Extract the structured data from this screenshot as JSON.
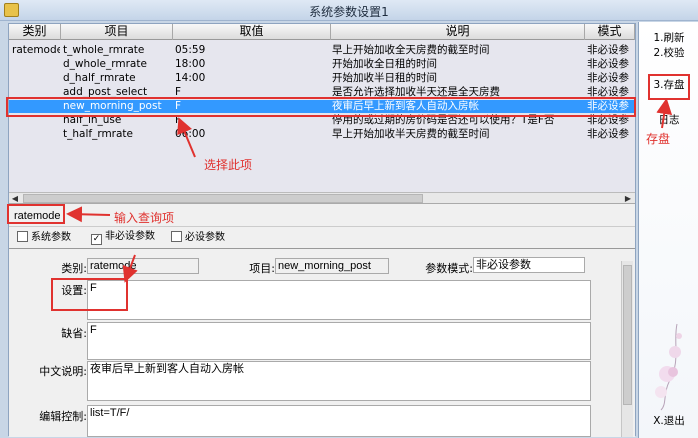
{
  "window": {
    "title": "系统参数设置1"
  },
  "grid": {
    "columns": [
      "类别",
      "项目",
      "取值",
      "说明",
      "模式"
    ],
    "rows": [
      {
        "category": "ratemode",
        "item": "t_whole_rmrate",
        "value": "05:59",
        "desc": "早上开始加收全天房费的截至时间",
        "mode": "非必设参"
      },
      {
        "category": "",
        "item": "d_whole_rmrate",
        "value": "18:00",
        "desc": "开始加收全日租的时间",
        "mode": "非必设参"
      },
      {
        "category": "",
        "item": "d_half_rmrate",
        "value": "14:00",
        "desc": "开始加收半日租的时间",
        "mode": "非必设参"
      },
      {
        "category": "",
        "item": "add_post_select",
        "value": "F",
        "desc": "是否允许选择加收半天还是全天房费",
        "mode": "非必设参"
      },
      {
        "category": "",
        "item": "new_morning_post",
        "value": "F",
        "desc": "夜审后早上新到客人自动入房帐",
        "mode": "非必设参"
      },
      {
        "category": "",
        "item": "half_in_use",
        "value": "F",
        "desc": "停用的或过期的房价码是否还可以使用？T是F否",
        "mode": "非必设参"
      },
      {
        "category": "",
        "item": "t_half_rmrate",
        "value": "06:00",
        "desc": "早上开始加收半天房费的截至时间",
        "mode": "非必设参"
      }
    ],
    "selected_index": 4
  },
  "query": {
    "value": "ratemode"
  },
  "filters": [
    {
      "label": "系统参数",
      "checked": false
    },
    {
      "label": "非必设参数",
      "checked": true
    },
    {
      "label": "必设参数",
      "checked": false
    }
  ],
  "detail": {
    "category_label": "类别:",
    "category_value": "ratemode",
    "item_label": "项目:",
    "item_value": "new_morning_post",
    "mode_label": "参数模式:",
    "mode_value": "非必设参数",
    "setting_label": "设置:",
    "setting_value": "F",
    "default_label": "缺省:",
    "default_value": "F",
    "desc_label": "中文说明:",
    "desc_value": "夜审后早上新到客人自动入房帐",
    "edit_label": "编辑控制:",
    "edit_value": "list=T/F/"
  },
  "sidebar": {
    "refresh": "1.刷新",
    "verify": "2.校验",
    "save": "3.存盘",
    "log": "日志",
    "exit": "X.退出"
  },
  "annotations": {
    "select_item": "选择此项",
    "input_query": "输入查询项",
    "save": "存盘"
  },
  "colors": {
    "selection": "#3399ff",
    "annotation": "#e0322f"
  }
}
